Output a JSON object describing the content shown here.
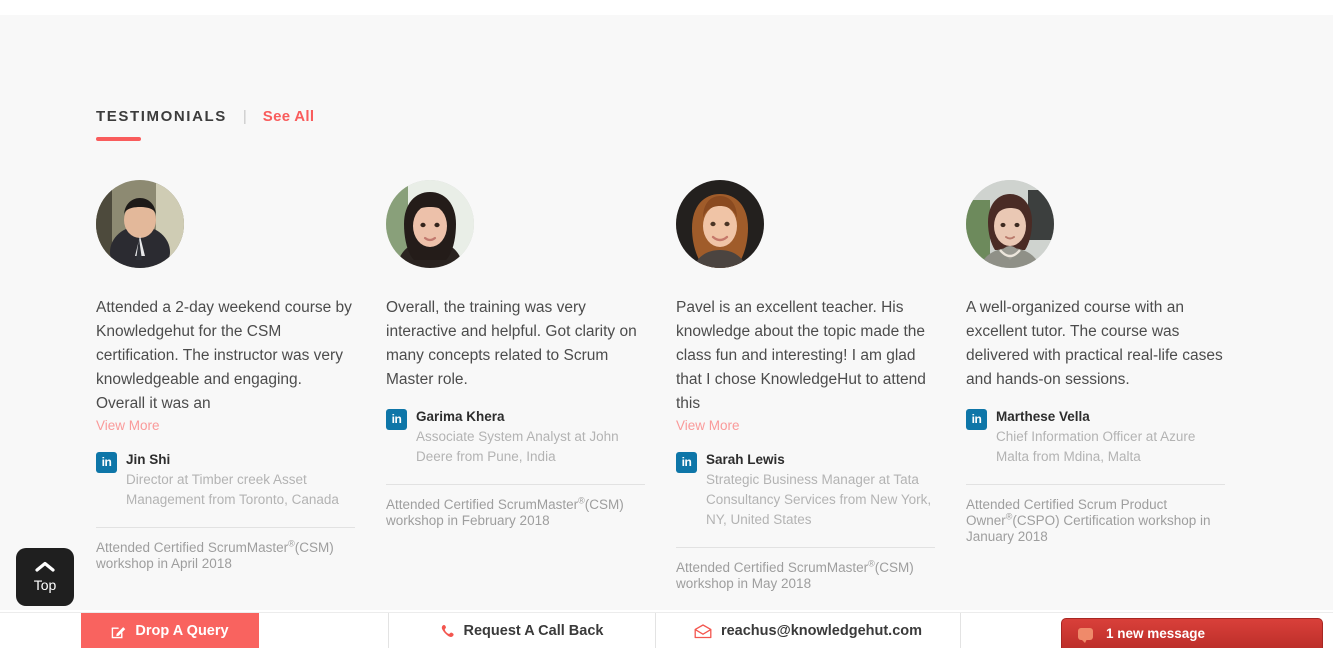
{
  "section": {
    "heading": "TESTIMONIALS",
    "separator": "|",
    "see_all": "See All"
  },
  "testimonials": [
    {
      "quote": "Attended a 2-day weekend course by Knowledgehut for the CSM certification. The instructor was very knowledgeable and engaging. Overall it was an",
      "view_more": "View More",
      "has_view_more": true,
      "name": "Jin Shi",
      "role": "Director at Timber creek Asset Management from Toronto, Canada",
      "course_pre": "Attended Certified ScrumMaster",
      "course_sup": "®",
      "course_post": "(CSM) workshop in April 2018",
      "social_icon": "linkedin-icon",
      "social_label": "in",
      "avatar_name": "avatar-jin-shi"
    },
    {
      "quote": "Overall, the training was very interactive and helpful. Got clarity on many concepts related to Scrum Master role.",
      "view_more": "",
      "has_view_more": false,
      "name": "Garima Khera",
      "role": "Associate System Analyst at John Deere from Pune, India",
      "course_pre": "Attended Certified ScrumMaster",
      "course_sup": "®",
      "course_post": "(CSM) workshop in February 2018",
      "social_icon": "linkedin-icon",
      "social_label": "in",
      "avatar_name": "avatar-garima-khera"
    },
    {
      "quote": "Pavel is an excellent teacher. His knowledge about the topic made the class fun and interesting! I am glad that I chose KnowledgeHut to attend this",
      "view_more": "View More",
      "has_view_more": true,
      "name": "Sarah Lewis",
      "role": "Strategic Business Manager at Tata Consultancy Services from New York, NY, United States",
      "course_pre": "Attended Certified ScrumMaster",
      "course_sup": "®",
      "course_post": "(CSM) workshop in May 2018",
      "social_icon": "linkedin-icon",
      "social_label": "in",
      "avatar_name": "avatar-sarah-lewis"
    },
    {
      "quote": "A well-organized course with an excellent tutor. The course was delivered with practical real-life cases and hands-on sessions.",
      "view_more": "",
      "has_view_more": false,
      "name": "Marthese Vella",
      "role": "Chief Information Officer at Azure Malta from Mdina, Malta",
      "course_pre": "Attended Certified Scrum Product Owner",
      "course_sup": "®",
      "course_post": "(CSPO) Certification workshop in January 2018",
      "social_icon": "linkedin-icon",
      "social_label": "in",
      "avatar_name": "avatar-marthese-vella"
    }
  ],
  "scroll_top": {
    "label": "Top",
    "icon": "chevron-up-icon"
  },
  "bottom_bar": {
    "drop_query": {
      "label": "Drop A Query",
      "icon": "pencil-square-icon"
    },
    "call_back": {
      "label": "Request A Call Back",
      "icon": "phone-icon"
    },
    "email": {
      "label": "reachus@knowledgehut.com",
      "icon": "envelope-icon"
    }
  },
  "chat_widget": {
    "label": "1 new message",
    "icon": "chat-bubble-icon"
  },
  "colors": {
    "accent": "#f95c5c",
    "query_button": "#f9635f",
    "chat_red": "#d9403a",
    "linkedin": "#0e76a8",
    "page_bg": "#f8f8f8",
    "view_more": "#fa9a9a"
  }
}
